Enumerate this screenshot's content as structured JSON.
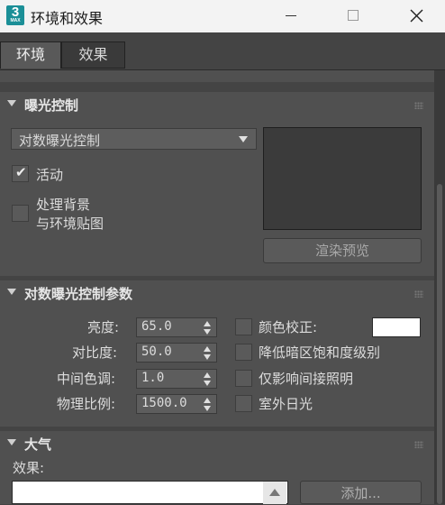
{
  "window": {
    "title": "环境和效果",
    "icon_label": "3",
    "icon_sub": "MAX"
  },
  "tabs": [
    {
      "label": "环境",
      "active": true
    },
    {
      "label": "效果",
      "active": false
    }
  ],
  "exposure": {
    "title": "曝光控制",
    "dropdown_value": "对数曝光控制",
    "active_label": "活动",
    "active_checked": true,
    "bg_label_line1": "处理背景",
    "bg_label_line2": "与环境贴图",
    "bg_checked": false,
    "render_preview_label": "渲染预览"
  },
  "log_params": {
    "title": "对数曝光控制参数",
    "brightness_label": "亮度:",
    "brightness_value": "65.0",
    "contrast_label": "对比度:",
    "contrast_value": "50.0",
    "midtones_label": "中间色调:",
    "midtones_value": "1.0",
    "physical_scale_label": "物理比例:",
    "physical_scale_value": "1500.0",
    "color_correction_label": "颜色校正:",
    "color_correction_color": "#ffffff",
    "desaturate_label": "降低暗区饱和度级别",
    "affect_indirect_label": "仅影响间接照明",
    "exterior_daylight_label": "室外日光"
  },
  "atmosphere": {
    "title": "大气",
    "effects_label": "效果:",
    "add_label": "添加..."
  },
  "colors": {
    "panel_bg": "#505050",
    "window_bg": "#444444",
    "titlebar_bg": "#f3f3f3",
    "accent_icon": "#1b8f97"
  }
}
